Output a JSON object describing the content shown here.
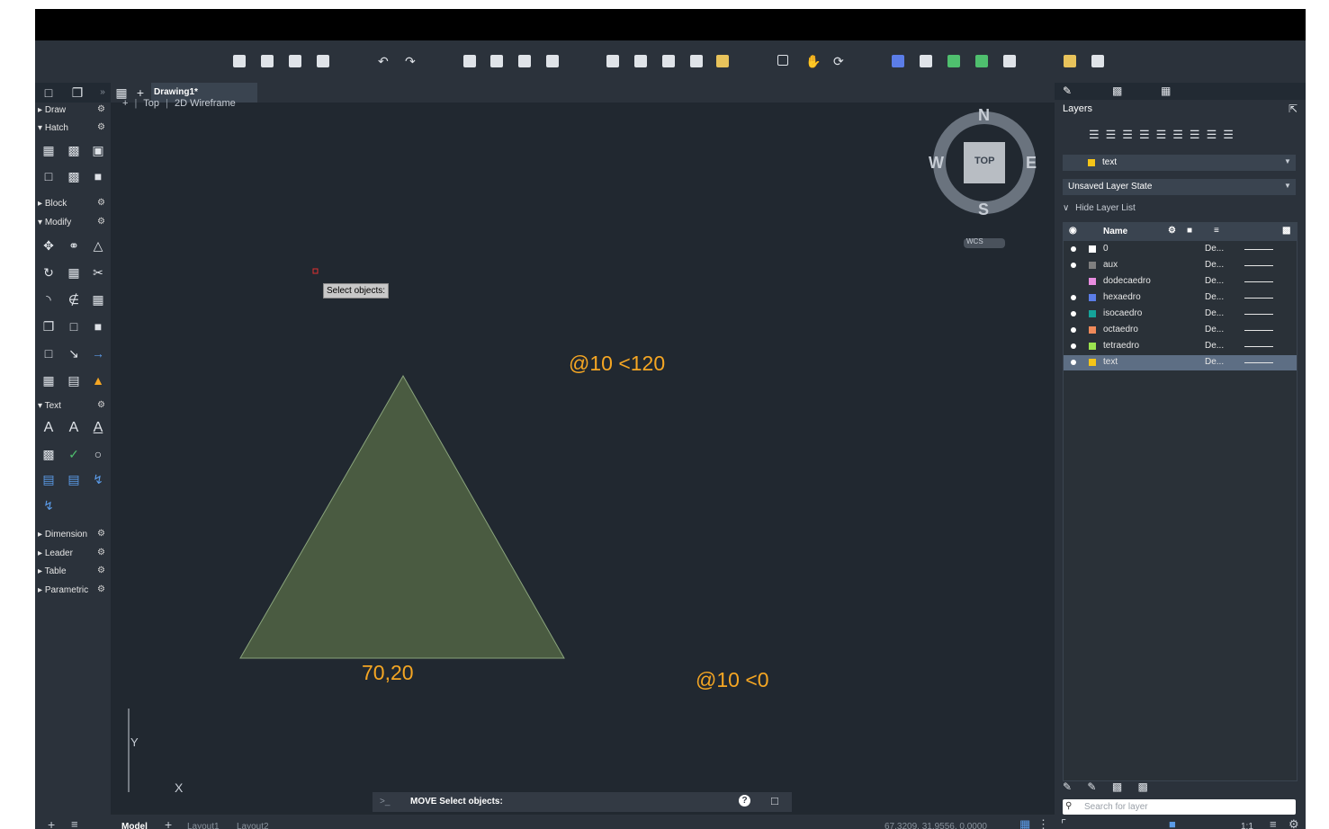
{
  "colors": {
    "canvas": "#212830",
    "panel": "#2b323b",
    "triangle_fill": "#4a5b41",
    "triangle_stroke": "#8aa47c",
    "annotation": "#f5a623"
  },
  "tabs": {
    "document": "Drawing1*"
  },
  "viewport": {
    "plus": "+",
    "view": "Top",
    "mode": "2D Wireframe"
  },
  "palette": {
    "sections": [
      "Draw",
      "Hatch",
      "Block",
      "Modify",
      "Text",
      "Dimension",
      "Leader",
      "Table",
      "Parametric"
    ]
  },
  "compass": {
    "n": "N",
    "e": "E",
    "s": "S",
    "w": "W",
    "cube": "TOP",
    "wcs": "WCS"
  },
  "canvas": {
    "tooltip": "Select objects:",
    "label_a": "@10 <120",
    "label_b": "70,20",
    "label_c": "@10 <0",
    "ucs_x": "X",
    "ucs_y": "Y"
  },
  "command": {
    "prompt": ">_",
    "text": "MOVE Select objects:"
  },
  "status": {
    "model": "Model",
    "layout1": "Layout1",
    "layout2": "Layout2",
    "coords": "67.3209, 31.9556, 0.0000",
    "scale": "1:1"
  },
  "layers_panel": {
    "title": "Layers",
    "current": "text",
    "state": "Unsaved Layer State",
    "hide": "Hide Layer List",
    "col_name": "Name",
    "rows": [
      {
        "name": "0",
        "color": "#ffffff",
        "desc": "De..."
      },
      {
        "name": "aux",
        "color": "#808080",
        "desc": "De..."
      },
      {
        "name": "dodecaedro",
        "color": "#e88de0",
        "desc": "De..."
      },
      {
        "name": "hexaedro",
        "color": "#5b7de8",
        "desc": "De..."
      },
      {
        "name": "isocaedro",
        "color": "#15a39a",
        "desc": "De..."
      },
      {
        "name": "octaedro",
        "color": "#f08a5a",
        "desc": "De..."
      },
      {
        "name": "tetraedro",
        "color": "#9be34f",
        "desc": "De..."
      },
      {
        "name": "text",
        "color": "#f5c518",
        "desc": "De..."
      }
    ],
    "search_placeholder": "Search for layer"
  }
}
